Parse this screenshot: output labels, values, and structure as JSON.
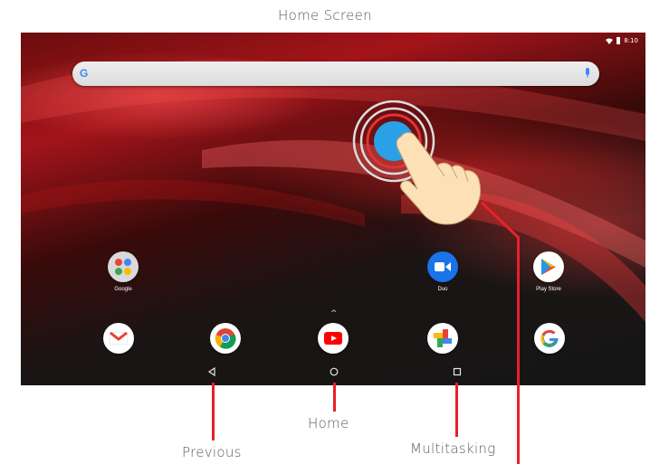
{
  "captions": {
    "title": "Home Screen",
    "home": "Home",
    "previous": "Previous",
    "multitasking": "Multitasking"
  },
  "status_bar": {
    "time": "8:10",
    "icons": [
      "wifi-icon",
      "battery-icon"
    ]
  },
  "search": {
    "logo": "G",
    "mic_icon": "mic-icon"
  },
  "apps_top": [
    {
      "label": "Google",
      "icon": "google-folder-icon"
    },
    {
      "label": "Duo",
      "icon": "duo-icon"
    },
    {
      "label": "Play Store",
      "icon": "play-store-icon"
    }
  ],
  "apps_dock": [
    {
      "label": "",
      "icon": "gmail-icon"
    },
    {
      "label": "",
      "icon": "chrome-icon"
    },
    {
      "label": "",
      "icon": "youtube-icon"
    },
    {
      "label": "",
      "icon": "photos-icon"
    },
    {
      "label": "",
      "icon": "google-icon"
    }
  ],
  "navbar": {
    "back": "back-icon",
    "home": "home-circle-icon",
    "recents": "recents-square-icon"
  },
  "colors": {
    "accent_red": "#e8202a",
    "caption_gray": "#5a5a5a",
    "tap_blue": "#2aa1e6"
  }
}
